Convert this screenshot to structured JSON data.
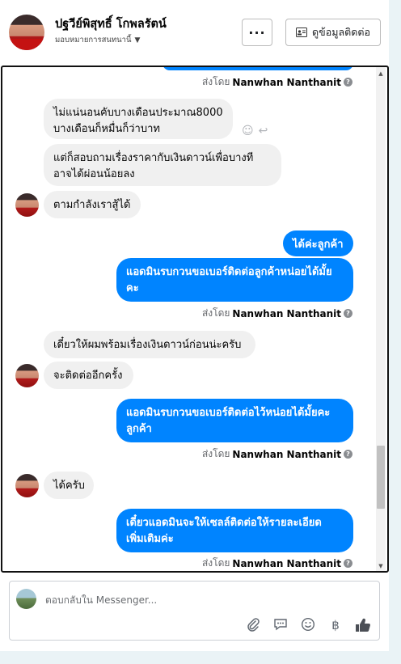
{
  "header": {
    "contact_name": "ปฐวีย์พิสุทธิ์ โกพลรัตน์",
    "assign_label": "มอบหมายการสนทนานี้",
    "more_label": "···",
    "info_button_label": "ดูข้อมูลติดต่อ"
  },
  "messages": [
    {
      "dir": "out-partial",
      "text": ""
    },
    {
      "dir": "sent-by",
      "prefix": "ส่งโดย",
      "name": "Nanwhan Nanthanit"
    },
    {
      "dir": "in",
      "text": "ไม่แน่นอนคับบางเดือนประมาณ8000\nบางเดือนก็หมื่นก็ว่าบาท"
    },
    {
      "dir": "in",
      "text": "แต่ก็สอบถามเรื่องราคากับเงินดาวน์เพื่อบางที\nอาจได้ผ่อนน้อยลง"
    },
    {
      "dir": "in",
      "text": "ตามกำลังเราสู้ได้"
    },
    {
      "dir": "out",
      "text": "ได้ค่ะลูกค้า"
    },
    {
      "dir": "out",
      "text": "แอดมินรบกวนขอเบอร์ติดต่อลูกค้าหน่อยได้มั้ย\nคะ"
    },
    {
      "dir": "sent-by",
      "prefix": "ส่งโดย",
      "name": "Nanwhan Nanthanit"
    },
    {
      "dir": "in",
      "text": "เดี๋ยวให้ผมพร้อมเรื่องเงินดาวน์ก่อนน่ะครับ"
    },
    {
      "dir": "in",
      "text": "จะติดต่ออีกครั้ง"
    },
    {
      "dir": "out",
      "text": "แอดมินรบกวนขอเบอร์ติดต่อไว้หน่อยได้มั้ยคะ\nลูกค้า"
    },
    {
      "dir": "sent-by",
      "prefix": "ส่งโดย",
      "name": "Nanwhan Nanthanit"
    },
    {
      "dir": "in",
      "text": "ได้ครับ"
    },
    {
      "dir": "out",
      "text": "เดี๋ยวแอดมินจะให้เซลล์ติดต่อให้รายละเอียด\nเพิ่มเติมค่ะ"
    },
    {
      "dir": "sent-by",
      "prefix": "ส่งโดย",
      "name": "Nanwhan Nanthanit"
    }
  ],
  "composer": {
    "placeholder": "ตอบกลับใน Messenger..."
  },
  "icons": {
    "more": "more-icon",
    "contact_card": "contact-card-icon",
    "attach": "paperclip-icon",
    "quick_reply": "quick-reply-icon",
    "emoji": "emoji-icon",
    "payment": "baht-icon",
    "like": "thumbs-up-icon",
    "react": "emoji-react-icon",
    "reply": "reply-icon",
    "help": "help-icon"
  },
  "colors": {
    "accent": "#0084ff",
    "incoming_bubble": "#f0f0f0",
    "border": "#111111"
  }
}
